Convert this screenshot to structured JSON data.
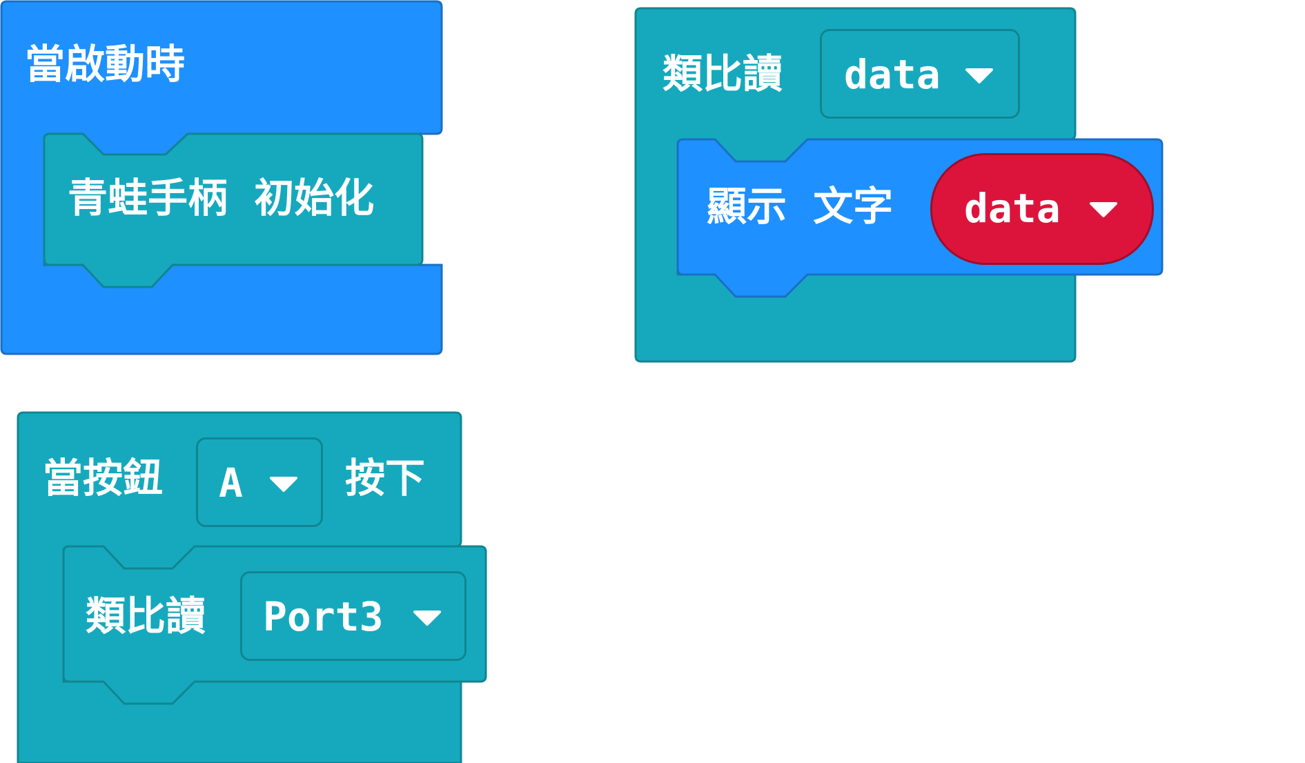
{
  "colors": {
    "events_blue": "#1e90ff",
    "events_blue_dark": "#1a6fc4",
    "extension_teal": "#16a9be",
    "extension_teal_dark": "#108591",
    "variable_red": "#dc143c",
    "variable_red_dark": "#a00d2b",
    "canvas_bg": "#ffffff"
  },
  "block_on_start": {
    "hat_label": "當啟動時",
    "inner_block_label": "青蛙手柄 初始化"
  },
  "block_analog_read_data": {
    "label": "類比讀",
    "dropdown_value": "data",
    "inner_block_label": "顯示 文字",
    "variable_value": "data"
  },
  "block_on_button": {
    "label_before": "當按鈕",
    "dropdown_value": "A",
    "label_after": "按下",
    "inner_block_label": "類比讀",
    "inner_dropdown_value": "Port3"
  },
  "icons": [
    "dropdown-caret-icon"
  ]
}
